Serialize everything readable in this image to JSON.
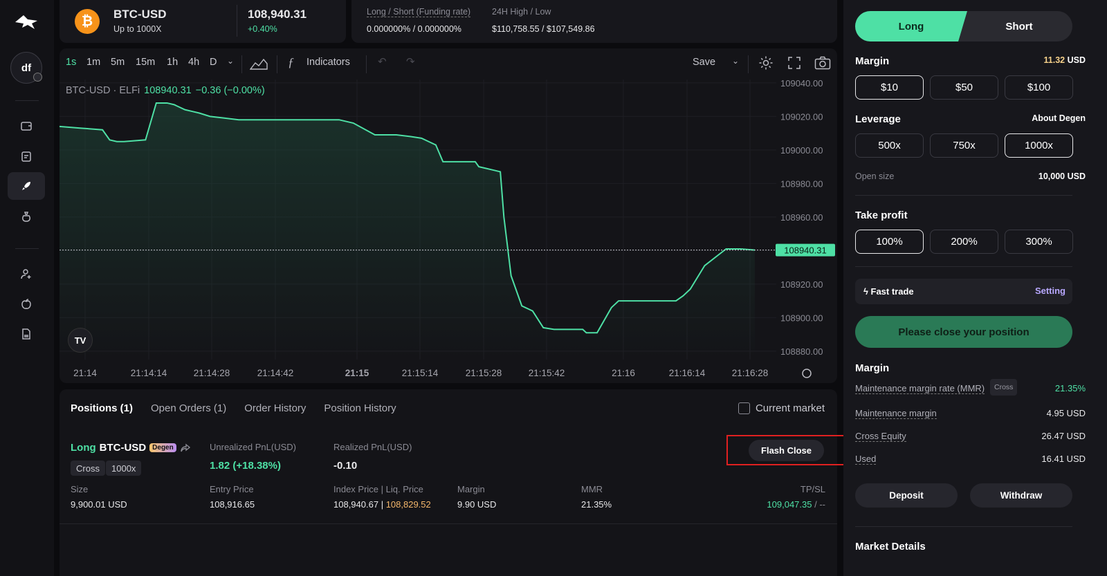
{
  "ticker": {
    "pair": "BTC-USD",
    "leverage_max": "Up to 1000X",
    "price": "108,940.31",
    "change": "+0.40%",
    "coin_glyph": "₿",
    "funding_label": "Long / Short (Funding rate)",
    "funding_value": "0.000000% / 0.000000%",
    "highlow_label": "24H High / Low",
    "highlow_value": "$110,758.55 / $107,549.86"
  },
  "sidebar": {
    "avatar_initials": "df",
    "items": [
      {
        "icon": "wallet-icon"
      },
      {
        "icon": "clipboard-icon"
      },
      {
        "icon": "rocket-icon"
      },
      {
        "icon": "money-bag-icon"
      },
      {
        "icon": "add-user-icon"
      },
      {
        "icon": "apple-icon"
      },
      {
        "icon": "doc-icon"
      }
    ]
  },
  "toolbar": {
    "timeframes": [
      "1s",
      "1m",
      "5m",
      "15m",
      "1h",
      "4h",
      "D"
    ],
    "indicators_label": "Indicators",
    "save_label": "Save"
  },
  "chart_header": {
    "symbol": "BTC-USD · ELFi",
    "price": "108940.31",
    "change": "−0.36 (−0.00%)"
  },
  "chart_data": {
    "type": "line",
    "x_ticks": [
      "21:14",
      "21:14:14",
      "21:14:28",
      "21:14:42",
      "21:15",
      "21:15:14",
      "21:15:28",
      "21:15:42",
      "21:16",
      "21:16:14",
      "21:16:28"
    ],
    "y_ticks": [
      "109040.00",
      "109020.00",
      "109000.00",
      "108980.00",
      "108960.00",
      "108940.00",
      "108920.00",
      "108900.00",
      "108880.00"
    ],
    "ylim": [
      108875,
      109042
    ],
    "last_price_label": "108940.31",
    "last_price": 108940.31,
    "line_color": "#4ee0a5",
    "series": [
      {
        "x": [
          0,
          0.03,
          0.06,
          0.07,
          0.08,
          0.09,
          0.12,
          0.135,
          0.15,
          0.16,
          0.175,
          0.185,
          0.195,
          0.21,
          0.23,
          0.25,
          0.27,
          0.29,
          0.32,
          0.36,
          0.39,
          0.41,
          0.44,
          0.47,
          0.49,
          0.505,
          0.515,
          0.525,
          0.535,
          0.56,
          0.58,
          0.585,
          0.595,
          0.605,
          0.615,
          0.62,
          0.63,
          0.645,
          0.655,
          0.66,
          0.675,
          0.69,
          0.71,
          0.73,
          0.735,
          0.745,
          0.75,
          0.77,
          0.78,
          0.8,
          0.82,
          0.83,
          0.85,
          0.86,
          0.87,
          0.88,
          0.9,
          0.93,
          0.95,
          0.97
        ],
        "y": [
          109014,
          109013,
          109012,
          109006,
          109005,
          109005,
          109006,
          109028,
          109028,
          109027,
          109024,
          109023,
          109022,
          109020,
          109019,
          109018,
          109018,
          109018,
          109018,
          109018,
          109018,
          109016,
          109009,
          109009,
          109008,
          109007,
          109005,
          109003,
          108993,
          108993,
          108993,
          108990,
          108989,
          108988,
          108987,
          108960,
          108925,
          108907,
          108905,
          108904,
          108894,
          108893,
          108893,
          108893,
          108891,
          108891,
          108891,
          108906,
          108910,
          108910,
          108910,
          108910,
          108910,
          108910,
          108913,
          108917,
          108931,
          108941,
          108941,
          108940.31
        ]
      }
    ]
  },
  "positions": {
    "tabs": [
      "Positions (1)",
      "Open Orders (1)",
      "Order History",
      "Position History"
    ],
    "current_market_label": "Current market",
    "row": {
      "side": "Long",
      "pair": "BTC-USD",
      "badge": "Degen",
      "margin_mode": "Cross",
      "leverage": "1000x",
      "upnl_label": "Unrealized PnL(USD)",
      "upnl_value": "1.82 (+18.38%)",
      "rpnl_label": "Realized PnL(USD)",
      "rpnl_value": "-0.10",
      "flash_close_label": "Flash Close",
      "size_label": "Size",
      "size_value": "9,900.01 USD",
      "entry_label": "Entry Price",
      "entry_value": "108,916.65",
      "index_label": "Index Price | Liq. Price",
      "index_value": "108,940.67",
      "liq_value": "108,829.52",
      "margin_label": "Margin",
      "margin_value": "9.90 USD",
      "mmr_label": "MMR",
      "mmr_value": "21.35%",
      "tpsl_label": "TP/SL",
      "tp_value": "109,047.35",
      "sl_value": "/ --"
    }
  },
  "order_panel": {
    "long_label": "Long",
    "short_label": "Short",
    "margin_label": "Margin",
    "margin_balance": "11.32",
    "margin_unit": "USD",
    "margin_options": [
      "$10",
      "$50",
      "$100"
    ],
    "leverage_label": "Leverage",
    "about_degen": "About Degen",
    "leverage_options": [
      "500x",
      "750x",
      "1000x"
    ],
    "open_size_label": "Open size",
    "open_size_value": "10,000 USD",
    "take_profit_label": "Take profit",
    "take_profit_options": [
      "100%",
      "200%",
      "300%"
    ],
    "fast_trade_label": "Fast trade",
    "setting_label": "Setting",
    "close_position_label": "Please close your position",
    "margin_section_label": "Margin",
    "mmr_label": "Maintenance margin rate (MMR)",
    "mmr_tag": "Cross",
    "mmr_value": "21.35%",
    "maint_margin_label": "Maintenance margin",
    "maint_margin_value": "4.95 USD",
    "cross_equity_label": "Cross Equity",
    "cross_equity_value": "26.47 USD",
    "used_label": "Used",
    "used_value": "16.41 USD",
    "deposit_label": "Deposit",
    "withdraw_label": "Withdraw",
    "market_details_label": "Market Details"
  },
  "colors": {
    "accent_green": "#4ee0a5",
    "liq_orange": "#f5b76b",
    "highlight_red": "#e02020"
  }
}
